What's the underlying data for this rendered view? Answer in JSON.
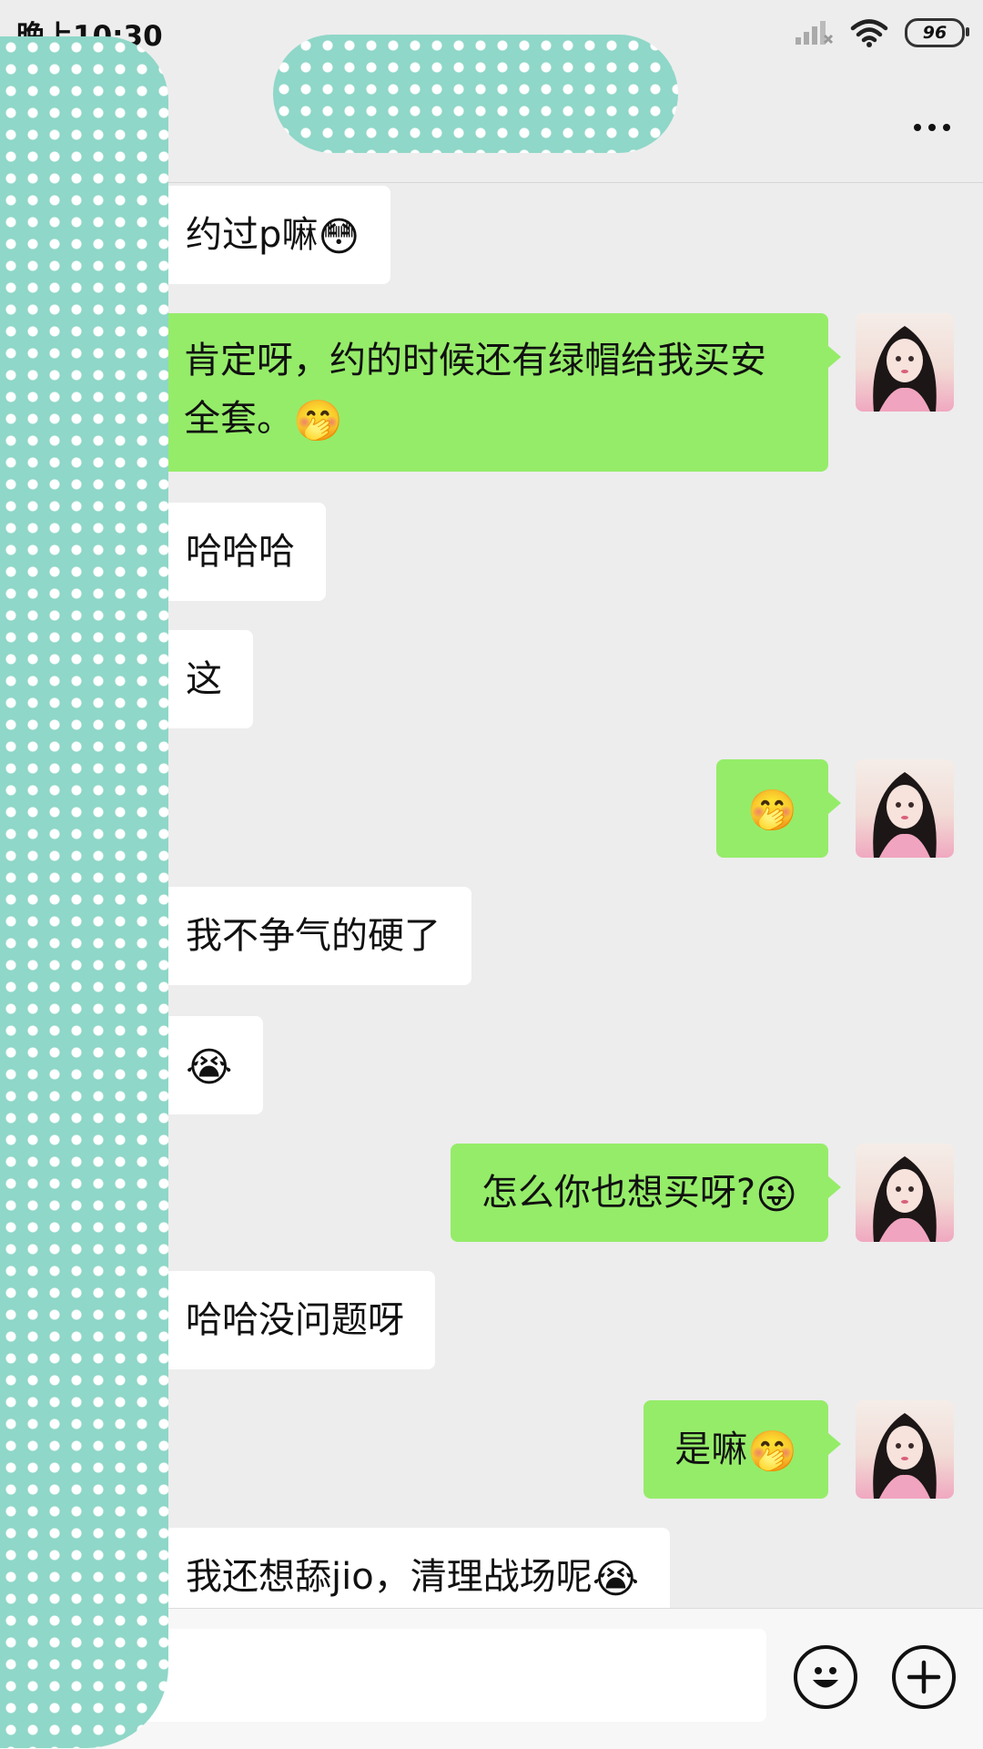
{
  "status_bar": {
    "time": "晚上10:30",
    "battery": "96"
  },
  "header": {
    "title": ""
  },
  "messages": [
    {
      "side": "in",
      "text": "约过p嘛",
      "emoji": "😳"
    },
    {
      "side": "out",
      "text": "肯定呀，约的时候还有绿帽给我买安全套。",
      "emoji": "🤭"
    },
    {
      "side": "in",
      "text": "哈哈哈",
      "emoji": ""
    },
    {
      "side": "in",
      "text": "这",
      "emoji": ""
    },
    {
      "side": "out",
      "text": "",
      "emoji": "🤭"
    },
    {
      "side": "in",
      "text": "我不争气的硬了",
      "emoji": ""
    },
    {
      "side": "in",
      "text": "",
      "emoji": "😭"
    },
    {
      "side": "out",
      "text": "怎么你也想买呀?",
      "emoji": "😜"
    },
    {
      "side": "in",
      "text": "哈哈没问题呀",
      "emoji": ""
    },
    {
      "side": "out",
      "text": "是嘛",
      "emoji": "🤭"
    },
    {
      "side": "in",
      "text": "我还想舔jio，清理战场呢",
      "emoji": "😭"
    }
  ],
  "icons": {
    "more": "more-dots-icon",
    "emoji": "smiley-icon",
    "add": "plus-icon",
    "wifi": "wifi-icon",
    "signal": "signal-icon"
  },
  "colors": {
    "outgoing": "#95ec69",
    "incoming": "#ffffff",
    "background": "#ededed"
  }
}
